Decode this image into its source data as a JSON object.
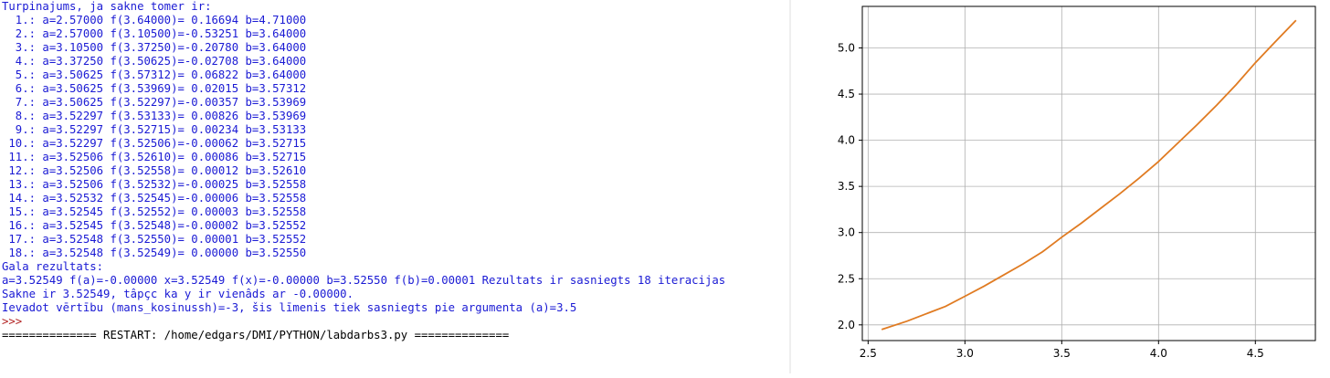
{
  "shell": {
    "header": "Turpinajums, ja sakne tomer ir:",
    "iterations": [
      "  1.: a=2.57000 f(3.64000)= 0.16694 b=4.71000",
      "  2.: a=2.57000 f(3.10500)=-0.53251 b=3.64000",
      "  3.: a=3.10500 f(3.37250)=-0.20780 b=3.64000",
      "  4.: a=3.37250 f(3.50625)=-0.02708 b=3.64000",
      "  5.: a=3.50625 f(3.57312)= 0.06822 b=3.64000",
      "  6.: a=3.50625 f(3.53969)= 0.02015 b=3.57312",
      "  7.: a=3.50625 f(3.52297)=-0.00357 b=3.53969",
      "  8.: a=3.52297 f(3.53133)= 0.00826 b=3.53969",
      "  9.: a=3.52297 f(3.52715)= 0.00234 b=3.53133",
      " 10.: a=3.52297 f(3.52506)=-0.00062 b=3.52715",
      " 11.: a=3.52506 f(3.52610)= 0.00086 b=3.52715",
      " 12.: a=3.52506 f(3.52558)= 0.00012 b=3.52610",
      " 13.: a=3.52506 f(3.52532)=-0.00025 b=3.52558",
      " 14.: a=3.52532 f(3.52545)=-0.00006 b=3.52558",
      " 15.: a=3.52545 f(3.52552)= 0.00003 b=3.52558",
      " 16.: a=3.52545 f(3.52548)=-0.00002 b=3.52552",
      " 17.: a=3.52548 f(3.52550)= 0.00001 b=3.52552",
      " 18.: a=3.52548 f(3.52549)= 0.00000 b=3.52550"
    ],
    "final_heading": "Gala rezultats:",
    "final_result": "a=3.52549 f(a)=-0.00000 x=3.52549 f(x)=-0.00000 b=3.52550 f(b)=0.00001 Rezultats ir sasniegts 18 iteracijas",
    "root_line": "Sakne ir 3.52549, tâpçc ka y ir vienâds ar -0.00000.",
    "input_line": "Ievadot vērtību (mans_kosinussh)=-3, šis līmenis tiek sasniegts pie argumenta (a)=3.5",
    "prompt": ">>>",
    "restart_line": "============== RESTART: /home/edgars/DMI/PYTHON/labdarbs3.py =============="
  },
  "colors": {
    "shell_output": "#1a1ad4",
    "prompt": "#b22222",
    "line": "#e07b22",
    "grid": "#b0b0b0"
  },
  "chart_data": {
    "type": "line",
    "title": "",
    "xlabel": "",
    "ylabel": "",
    "xlim": [
      2.47,
      4.81
    ],
    "ylim": [
      1.83,
      5.45
    ],
    "xticks": [
      2.5,
      3.0,
      3.5,
      4.0,
      4.5
    ],
    "yticks": [
      2.0,
      2.5,
      3.0,
      3.5,
      4.0,
      4.5,
      5.0
    ],
    "xtick_labels": [
      "2.5",
      "3.0",
      "3.5",
      "4.0",
      "4.5"
    ],
    "ytick_labels": [
      "2.0",
      "2.5",
      "3.0",
      "3.5",
      "4.0",
      "4.5",
      "5.0"
    ],
    "grid": true,
    "series": [
      {
        "x": [
          2.57,
          2.7,
          2.8,
          2.9,
          3.0,
          3.1,
          3.2,
          3.3,
          3.4,
          3.5,
          3.6,
          3.7,
          3.8,
          3.9,
          4.0,
          4.1,
          4.2,
          4.3,
          4.4,
          4.5,
          4.6,
          4.71
        ],
        "y": [
          1.95,
          2.04,
          2.12,
          2.2,
          2.31,
          2.42,
          2.54,
          2.66,
          2.79,
          2.95,
          3.1,
          3.26,
          3.42,
          3.59,
          3.77,
          3.97,
          4.17,
          4.38,
          4.6,
          4.84,
          5.06,
          5.3
        ]
      }
    ]
  }
}
